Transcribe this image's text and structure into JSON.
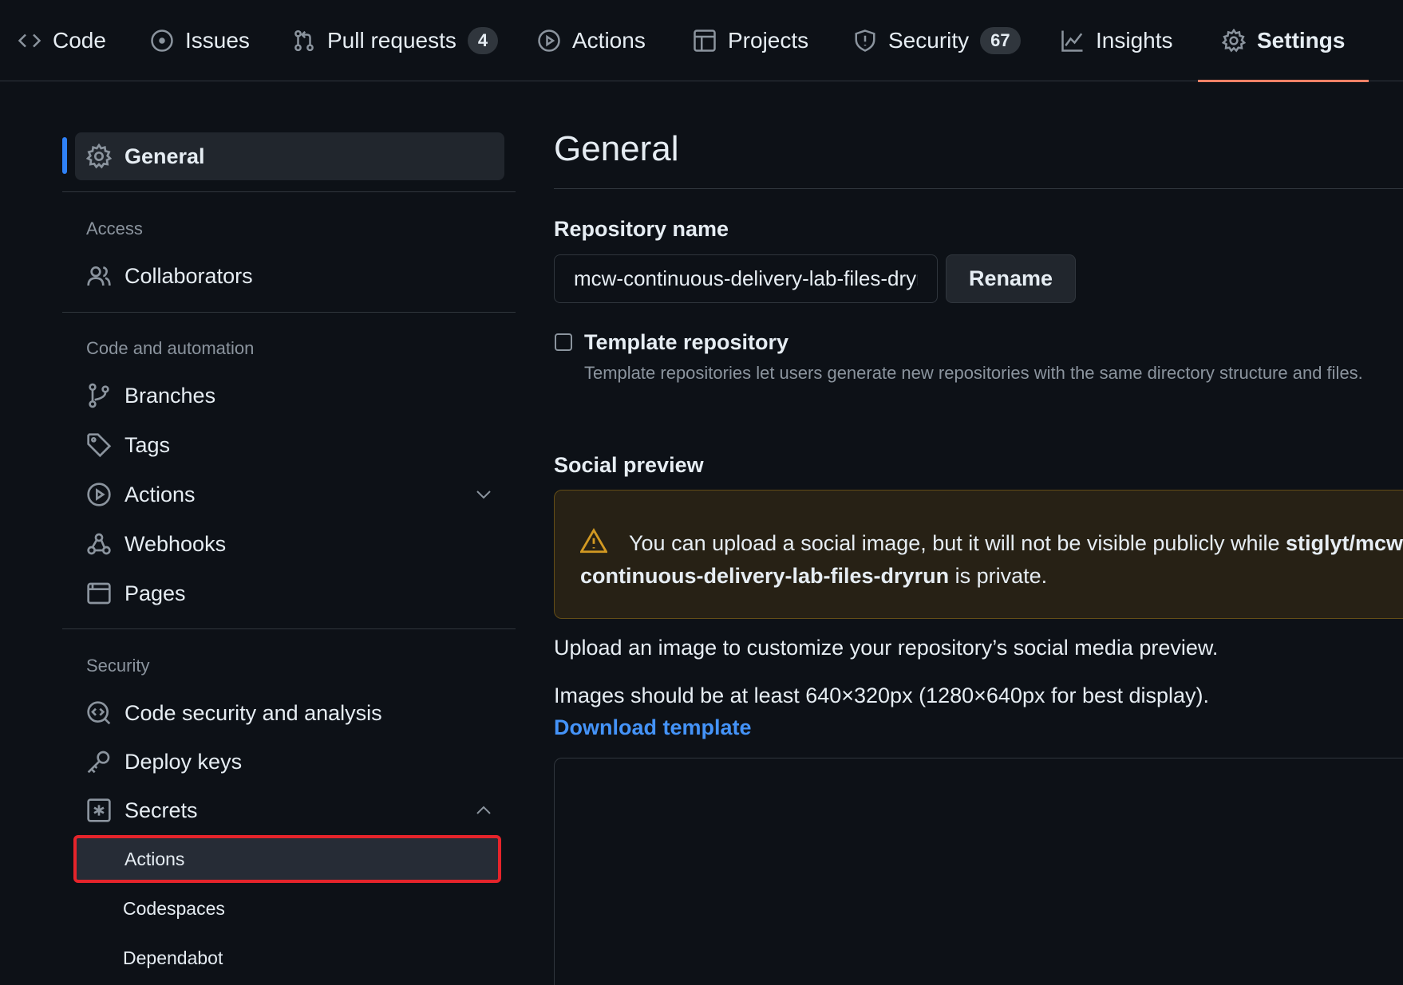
{
  "topnav": {
    "tabs": [
      {
        "label": "Code"
      },
      {
        "label": "Issues"
      },
      {
        "label": "Pull requests",
        "count": "4"
      },
      {
        "label": "Actions"
      },
      {
        "label": "Projects"
      },
      {
        "label": "Security",
        "count": "67"
      },
      {
        "label": "Insights"
      },
      {
        "label": "Settings",
        "selected": true
      }
    ]
  },
  "sidebar": {
    "general": "General",
    "access_heading": "Access",
    "collaborators": "Collaborators",
    "code_heading": "Code and automation",
    "branches": "Branches",
    "tags": "Tags",
    "actions": "Actions",
    "webhooks": "Webhooks",
    "pages": "Pages",
    "security_heading": "Security",
    "code_security": "Code security and analysis",
    "deploy_keys": "Deploy keys",
    "secrets": "Secrets",
    "secrets_sub": [
      "Actions",
      "Codespaces",
      "Dependabot"
    ]
  },
  "main": {
    "title": "General",
    "repo_name_label": "Repository name",
    "repo_name_value": "mcw-continuous-delivery-lab-files-dryrun",
    "rename_button": "Rename",
    "template_label": "Template repository",
    "template_desc": "Template repositories let users generate new repositories with the same directory structure and files.",
    "social_title": "Social preview",
    "warning_pre": "You can upload a social image, but it will not be visible publicly while ",
    "warning_repo": "stiglyt/mcw-continuous-delivery-lab-files-dryrun",
    "warning_post": " is private.",
    "upload_text": "Upload an image to customize your repository’s social media preview.",
    "size_text": "Images should be at least 640×320px (1280×640px for best display).",
    "download_link": "Download template"
  },
  "colors": {
    "background": "#0d1117",
    "border": "#30363d",
    "accent_underline": "#f78166",
    "link": "#4493f8",
    "active_bar": "#2f81f7",
    "highlight_box": "#e5242b",
    "warning_icon": "#d29922"
  }
}
